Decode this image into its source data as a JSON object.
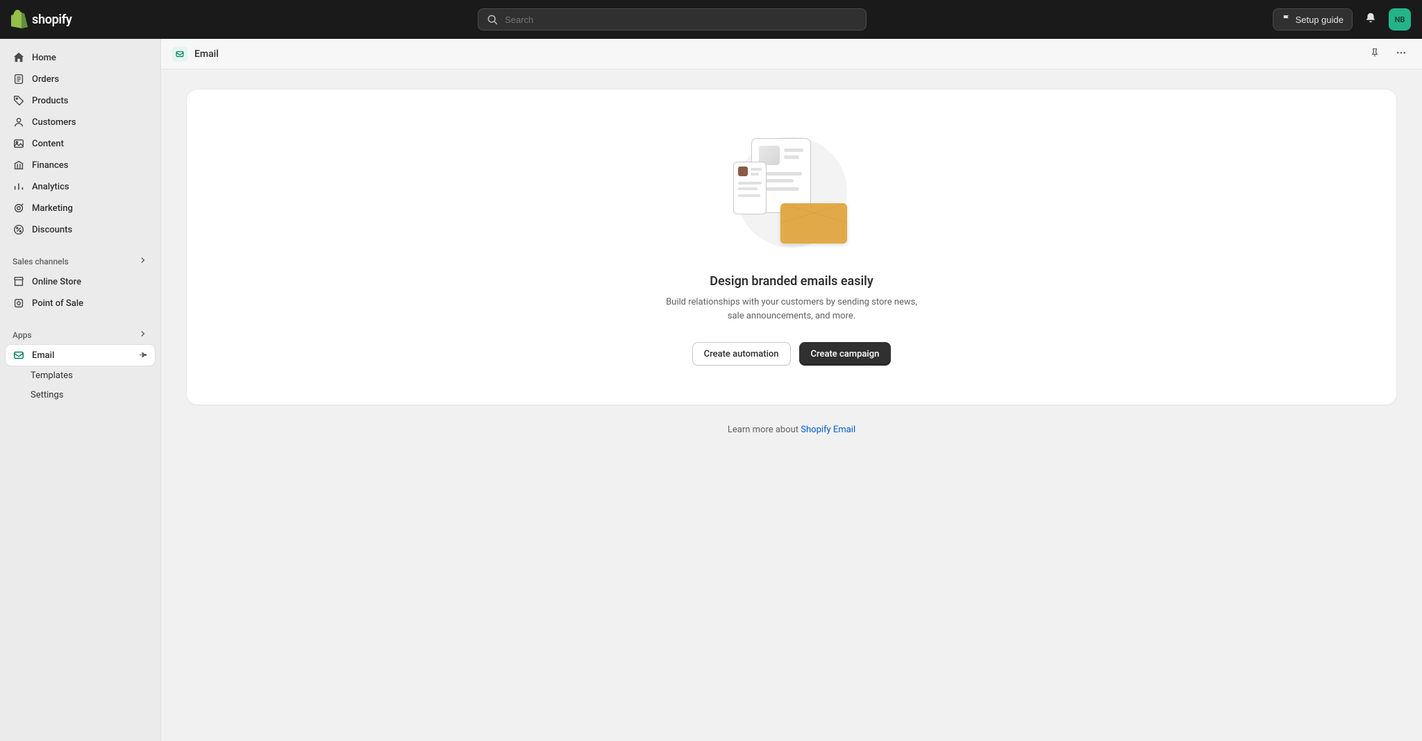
{
  "top": {
    "search_placeholder": "Search",
    "setup_guide": "Setup guide",
    "avatar_initials": "NB"
  },
  "nav": {
    "items": [
      {
        "label": "Home"
      },
      {
        "label": "Orders"
      },
      {
        "label": "Products"
      },
      {
        "label": "Customers"
      },
      {
        "label": "Content"
      },
      {
        "label": "Finances"
      },
      {
        "label": "Analytics"
      },
      {
        "label": "Marketing"
      },
      {
        "label": "Discounts"
      }
    ],
    "section_sales": "Sales channels",
    "sales": [
      {
        "label": "Online Store"
      },
      {
        "label": "Point of Sale"
      }
    ],
    "section_apps": "Apps",
    "apps": {
      "email": "Email",
      "templates": "Templates",
      "settings": "Settings"
    }
  },
  "header": {
    "title": "Email"
  },
  "card": {
    "heading": "Design branded emails easily",
    "subtext": "Build relationships with your customers by sending store news, sale announcements, and more.",
    "btn_automation": "Create automation",
    "btn_campaign": "Create campaign"
  },
  "learn": {
    "prefix": "Learn more about ",
    "link_text": "Shopify Email"
  }
}
